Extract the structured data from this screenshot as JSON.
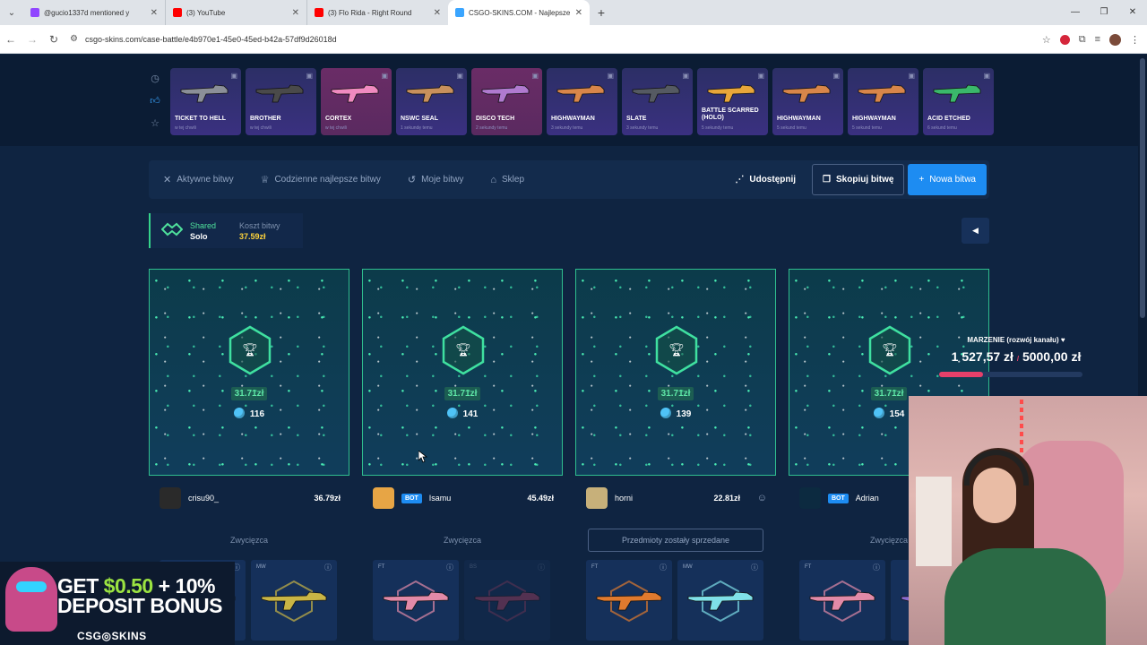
{
  "browser": {
    "tabs": [
      {
        "title": "@gucio1337d mentioned y",
        "favicon_color": "#9146ff",
        "active": false
      },
      {
        "title": "(3) YouTube",
        "favicon_color": "#ff0000",
        "active": false
      },
      {
        "title": "(3) Flo Rida - Right Round",
        "favicon_color": "#ff0000",
        "active": false
      },
      {
        "title": "CSGO-SKINS.COM - Najlepsze",
        "favicon_color": "#3aa5ff",
        "active": true
      }
    ],
    "url": "csgo-skins.com/case-battle/e4b970e1-45e0-45ed-b42a-57df9d26018d"
  },
  "live_drops": [
    {
      "name": "TICKET TO HELL",
      "sub": "w tej chwili",
      "pink": false
    },
    {
      "name": "BROTHER",
      "sub": "w tej chwili",
      "pink": false
    },
    {
      "name": "CORTEX",
      "sub": "w tej chwili",
      "pink": true
    },
    {
      "name": "NSWC SEAL",
      "sub": "1 sekundę temu",
      "pink": false
    },
    {
      "name": "DISCO TECH",
      "sub": "2 sekundy temu",
      "pink": true
    },
    {
      "name": "HIGHWAYMAN",
      "sub": "3 sekundy temu",
      "pink": false
    },
    {
      "name": "SLATE",
      "sub": "3 sekundy temu",
      "pink": false
    },
    {
      "name": "BATTLE SCARRED (HOLO)",
      "sub": "5 sekundy temu",
      "pink": false
    },
    {
      "name": "HIGHWAYMAN",
      "sub": "5 sekund temu",
      "pink": false
    },
    {
      "name": "HIGHWAYMAN",
      "sub": "5 sekund temu",
      "pink": false
    },
    {
      "name": "ACID ETCHED",
      "sub": "6 sekund temu",
      "pink": false
    }
  ],
  "nav": {
    "active": "Aktywne bitwy",
    "daily": "Codzienne najlepsze bitwy",
    "mine": "Moje bitwy",
    "shop": "Sklep",
    "share": "Udostępnij",
    "copy": "Skopiuj bitwę",
    "new": "Nowa bitwa"
  },
  "mode": {
    "type": "Shared",
    "format": "Solo",
    "cost_label": "Koszt bitwy",
    "cost_value": "37.59zł"
  },
  "players": [
    {
      "amount": "31.71zł",
      "tickets": "116",
      "name": "crisu90_",
      "bot": false,
      "value": "36.79zł",
      "status": "Zwycięzca",
      "sold": false,
      "smile": false,
      "avatar_color": "#2a2a2a",
      "items": [
        {
          "q": "",
          "dim": false,
          "color": "#8a6bd1"
        },
        {
          "q": "MW",
          "dim": false,
          "color": "#c9b545"
        }
      ]
    },
    {
      "amount": "31.71zł",
      "tickets": "141",
      "name": "Isamu",
      "bot": true,
      "value": "45.49zł",
      "status": "Zwycięzca",
      "sold": false,
      "smile": false,
      "avatar_color": "#e7a545",
      "items": [
        {
          "q": "FT",
          "dim": false,
          "color": "#e28aa8"
        },
        {
          "q": "BS",
          "dim": true,
          "color": "#d24a6f"
        }
      ]
    },
    {
      "amount": "31.71zł",
      "tickets": "139",
      "name": "horni",
      "bot": false,
      "value": "22.81zł",
      "status": "Przedmioty zostały sprzedane",
      "sold": true,
      "smile": true,
      "avatar_color": "#c7b07a",
      "items": [
        {
          "q": "FT",
          "dim": false,
          "color": "#e07a2e"
        },
        {
          "q": "MW",
          "dim": false,
          "color": "#7fe0e8"
        }
      ]
    },
    {
      "amount": "31.71zł",
      "tickets": "154",
      "name": "Adrian",
      "bot": true,
      "value": "",
      "status": "Zwycięzca",
      "sold": false,
      "smile": false,
      "avatar_color": "#0c2a40",
      "items": [
        {
          "q": "FT",
          "dim": false,
          "color": "#e28aa8"
        },
        {
          "q": "",
          "dim": false,
          "color": "#8a6bd1"
        }
      ]
    }
  ],
  "overlay": {
    "goal_title": "MARZENIE (rozwój kanału) ♥",
    "goal_current": "1 527,57 zł",
    "goal_target": "5000,00 zł",
    "goal_progress": 0.305,
    "promo_line1_prefix": "GET ",
    "promo_line1_highlight": "$0.50",
    "promo_line1_suffix": " + 10%",
    "promo_line2": "DEPOSIT BONUS",
    "promo_logo": "CSG◎SKINS"
  }
}
